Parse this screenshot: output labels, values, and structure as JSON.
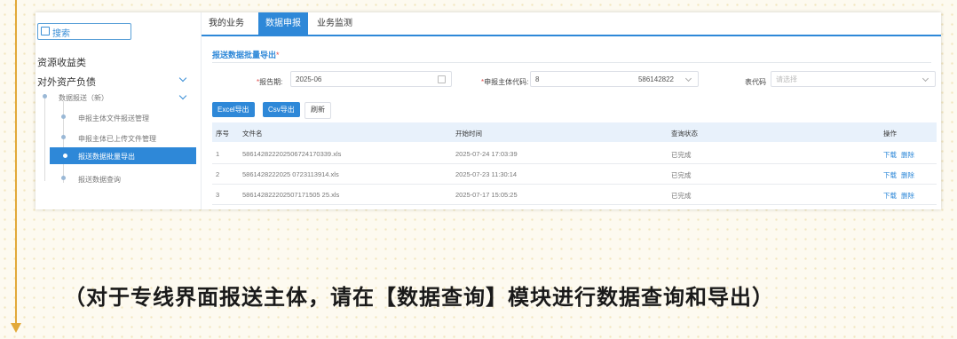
{
  "sidebar": {
    "search_label": "搜索",
    "items": [
      {
        "label": "资源收益类"
      },
      {
        "label": "对外资产负债"
      }
    ],
    "subgroup": "数据报送（新）",
    "subitems": [
      {
        "label": "申报主体文件报送管理"
      },
      {
        "label": "申报主体已上传文件管理"
      },
      {
        "label": "报送数据批量导出"
      },
      {
        "label": "报送数据查询"
      }
    ]
  },
  "tabs": [
    {
      "label": "我的业务"
    },
    {
      "label": "数据申报"
    },
    {
      "label": "业务监测"
    }
  ],
  "section": {
    "title": "报送数据批量导出",
    "star": "*"
  },
  "form": {
    "period_label": "报告期:",
    "period_value": "2025-06",
    "entity_label": "申报主体代码:",
    "entity_value_left": "8",
    "entity_value_right": "586142822",
    "table_label": "表代码",
    "table_placeholder": "请选择",
    "required_mark": "*"
  },
  "buttons": {
    "excel": "Excel导出",
    "csv": "Csv导出",
    "refresh": "刷新"
  },
  "table": {
    "headers": [
      "序号",
      "文件名",
      "开始时间",
      "查询状态",
      "操作"
    ],
    "rows": [
      {
        "no": "1",
        "file": "586142822202506724170339.xls",
        "time": "2025-07-24 17:03:39",
        "status": "已完成",
        "download": "下载",
        "delete": "删除"
      },
      {
        "no": "2",
        "file": "5861428222025 0723113914.xls",
        "time": "2025-07-23 11:30:14",
        "status": "已完成",
        "download": "下载",
        "delete": "删除"
      },
      {
        "no": "3",
        "file": "586142822202507171505 25.xls",
        "time": "2025-07-17 15:05:25",
        "status": "已完成",
        "download": "下载",
        "delete": "删除"
      }
    ]
  },
  "caption": "（对于专线界面报送主体，请在【数据查询】模块进行数据查询和导出）"
}
